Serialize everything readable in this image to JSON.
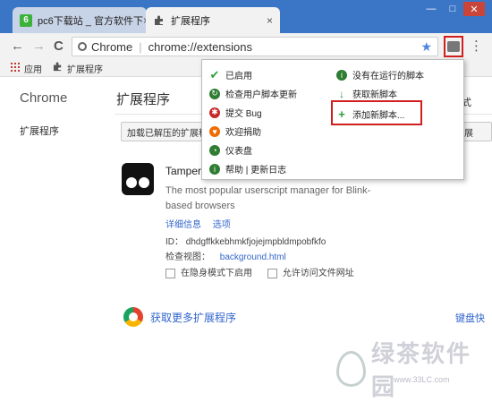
{
  "tabs": [
    {
      "label": "pc6下载站 _ 官方软件下",
      "favicon": "6",
      "close": "×"
    },
    {
      "label": "扩展程序",
      "favicon": "puzzle-icon",
      "close": "×"
    }
  ],
  "window_controls": {
    "minimize": "—",
    "maximize": "□",
    "close": "✕"
  },
  "toolbar": {
    "back": "←",
    "forward": "→",
    "reload": "C",
    "site_label": "Chrome",
    "url": "chrome://extensions",
    "star": "★",
    "menu": "⋮"
  },
  "bookmarks": [
    {
      "label": "应用",
      "icon": "apps-grid-icon"
    },
    {
      "label": "扩展程序",
      "icon": "puzzle-icon"
    }
  ],
  "sidebar": {
    "title": "Chrome",
    "item": "扩展程序"
  },
  "main": {
    "title": "扩展程序",
    "load_unpacked": "加载已解压的扩展程",
    "right_text_1": "式",
    "right_text_2": "展"
  },
  "extension": {
    "name": "Tamper",
    "description": "The most popular userscript manager for Blink-based browsers",
    "details_link": "详细信息",
    "options_link": "选项",
    "id_label": "ID：",
    "id": "dhdgffkkebhmkfjojejmpbldmpobfkfo",
    "inspect_label": "检查视图：",
    "inspect_link": "background.html",
    "incognito": "在隐身模式下启用",
    "file_access": "允许访问文件网址"
  },
  "more_extensions": "获取更多扩展程序",
  "shortcuts": "键盘快",
  "menu": {
    "left": [
      {
        "label": "已启用",
        "icon": "check-icon",
        "color": "#2e9e3c"
      },
      {
        "label": "检查用户脚本更新",
        "icon": "refresh-icon",
        "color": "#2e7d32"
      },
      {
        "label": "提交 Bug",
        "icon": "bug-icon",
        "color": "#c62828"
      },
      {
        "label": "欢迎捐助",
        "icon": "donate-icon",
        "color": "#ef6c00"
      },
      {
        "label": "仪表盘",
        "icon": "dashboard-icon",
        "color": "#2e7d32"
      },
      {
        "label": "帮助 | 更新日志",
        "icon": "help-icon",
        "color": "#2e7d32"
      }
    ],
    "right": [
      {
        "label": "没有在运行的脚本",
        "icon": "info-icon",
        "color": "#2e7d32"
      },
      {
        "label": "获取新脚本",
        "icon": "download-icon",
        "color": "#2e9e3c"
      },
      {
        "label": "添加新脚本...",
        "icon": "add-icon",
        "color": "#2e9e3c"
      }
    ]
  },
  "watermark": {
    "text": "绿茶软件园",
    "url": "www.33LC.com"
  },
  "colors": {
    "titlebar": "#3b76c6",
    "highlight": "#d11f1f",
    "link": "#3266cc"
  }
}
